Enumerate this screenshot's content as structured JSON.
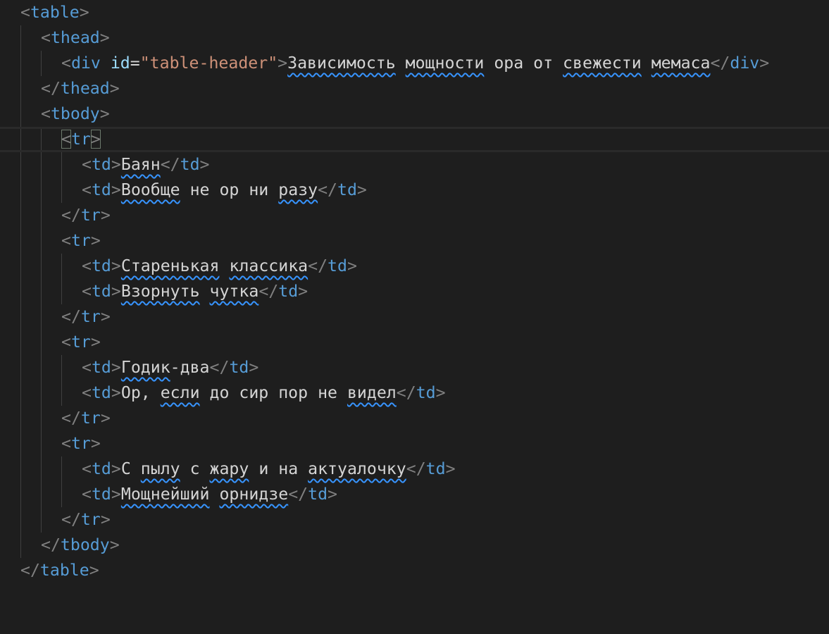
{
  "code": {
    "lines": [
      {
        "open": "<",
        "tag": "table",
        "close": ">"
      },
      {
        "open": "<",
        "tag": "thead",
        "close": ">"
      },
      {
        "open": "<",
        "tag": "div",
        "attr": "id",
        "eq": "=",
        "value": "\"table-header\"",
        "close": ">",
        "text": [
          "Зависимость",
          " ",
          "мощности",
          " ора от ",
          "свежести",
          " ",
          "мемаса"
        ],
        "end_open": "</",
        "end_tag": "div",
        "end_close": ">"
      },
      {
        "open": "</",
        "tag": "thead",
        "close": ">"
      },
      {
        "open": "<",
        "tag": "tbody",
        "close": ">"
      },
      {
        "open": "<",
        "tag": "tr",
        "close": ">"
      },
      {
        "open": "<",
        "tag": "td",
        "close": ">",
        "text": [
          "Баян"
        ],
        "end_open": "</",
        "end_tag": "td",
        "end_close": ">"
      },
      {
        "open": "<",
        "tag": "td",
        "close": ">",
        "text": [
          "Вообще",
          " не ор ни ",
          "разу"
        ],
        "end_open": "</",
        "end_tag": "td",
        "end_close": ">"
      },
      {
        "open": "</",
        "tag": "tr",
        "close": ">"
      },
      {
        "open": "<",
        "tag": "tr",
        "close": ">"
      },
      {
        "open": "<",
        "tag": "td",
        "close": ">",
        "text": [
          "Старенькая",
          " ",
          "классика"
        ],
        "end_open": "</",
        "end_tag": "td",
        "end_close": ">"
      },
      {
        "open": "<",
        "tag": "td",
        "close": ">",
        "text": [
          "Взорнуть",
          " ",
          "чутка"
        ],
        "end_open": "</",
        "end_tag": "td",
        "end_close": ">"
      },
      {
        "open": "</",
        "tag": "tr",
        "close": ">"
      },
      {
        "open": "<",
        "tag": "tr",
        "close": ">"
      },
      {
        "open": "<",
        "tag": "td",
        "close": ">",
        "text": [
          "Годик",
          "-два"
        ],
        "end_open": "</",
        "end_tag": "td",
        "end_close": ">"
      },
      {
        "open": "<",
        "tag": "td",
        "close": ">",
        "text": [
          "Ор, ",
          "если",
          " до сир пор не ",
          "видел"
        ],
        "end_open": "</",
        "end_tag": "td",
        "end_close": ">"
      },
      {
        "open": "</",
        "tag": "tr",
        "close": ">"
      },
      {
        "open": "<",
        "tag": "tr",
        "close": ">"
      },
      {
        "open": "<",
        "tag": "td",
        "close": ">",
        "text": [
          "С ",
          "пылу",
          " с ",
          "жару",
          " и на ",
          "актуалочку"
        ],
        "end_open": "</",
        "end_tag": "td",
        "end_close": ">"
      },
      {
        "open": "<",
        "tag": "td",
        "close": ">",
        "text": [
          "Мощнейший",
          " ",
          "орнидзе"
        ],
        "end_open": "</",
        "end_tag": "td",
        "end_close": ">"
      },
      {
        "open": "</",
        "tag": "tr",
        "close": ">"
      },
      {
        "open": "</",
        "tag": "tbody",
        "close": ">"
      },
      {
        "open": "</",
        "tag": "table",
        "close": ">"
      }
    ]
  },
  "colors": {
    "background": "#1e1e1e",
    "tag": "#569cd6",
    "bracket": "#808080",
    "attribute": "#9cdcfe",
    "string": "#ce9178",
    "text": "#d4d4d4",
    "spellcheck_squiggle": "#3794ff"
  }
}
